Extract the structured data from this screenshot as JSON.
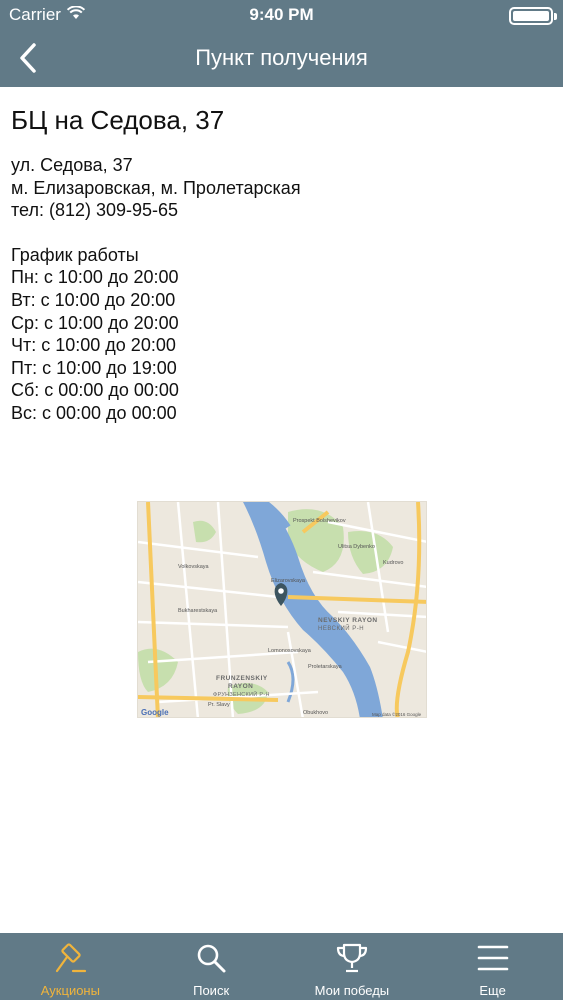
{
  "status_bar": {
    "carrier": "Carrier",
    "time": "9:40 PM"
  },
  "nav": {
    "title": "Пункт получения",
    "back_icon": "chevron-left-icon"
  },
  "place": {
    "title": "БЦ на Седова, 37",
    "address": "ул. Седова, 37",
    "metro": "м. Елизаровская, м. Пролетарская",
    "phone": "тел: (812) 309-95-65"
  },
  "schedule": {
    "heading": "График работы",
    "days": [
      "Пн: с 10:00 до 20:00",
      "Вт: с 10:00 до 20:00",
      "Ср: с 10:00 до 20:00",
      "Чт: с 10:00 до 20:00",
      "Пт: с 10:00 до 19:00",
      "Сб: с 00:00 до 00:00",
      "Вс: с 00:00 до 00:00"
    ]
  },
  "map": {
    "google_label": "Google",
    "copyright": "Map data ©2016 Google",
    "labels": {
      "district_nevsky": "NEVSKIY RAYON",
      "district_nevsky_ru": "НЕВСКИЙ Р-Н",
      "district_frunzensky": "FRUNZENSKIY",
      "district_frunzensky_2": "RAYON",
      "district_frunzensky_ru": "ФРУНЗЕНСКИЙ Р-Н",
      "obukhovo": "Obukhovo",
      "proletarskaya": "Proletarskaya",
      "elizarovskaya": "Elizarovskaya",
      "volkovskaya": "Volkovskaya",
      "kupchino": "Kudrovo",
      "prospekt_bolshevikov": "Prospekt Bolshevikov",
      "dybenko": "Ulitsa Dybenko",
      "bukharestskaya": "Bukharestskaya",
      "fr_slavy": "Pr. Slavy",
      "lomonosovskaya": "Lomonosovskaya"
    },
    "colors": {
      "land": "#ede8de",
      "water": "#7fa7d8",
      "park": "#c7dfae",
      "major_road": "#f7c95e",
      "minor_road": "#ffffff",
      "pin": "#3d5560"
    }
  },
  "tabs": [
    {
      "label": "Аукционы",
      "icon": "gavel-icon",
      "active": true
    },
    {
      "label": "Поиск",
      "icon": "search-icon",
      "active": false
    },
    {
      "label": "Мои победы",
      "icon": "trophy-icon",
      "active": false
    },
    {
      "label": "Еще",
      "icon": "menu-icon",
      "active": false
    }
  ],
  "colors": {
    "header": "#617a87",
    "active_tab": "#f0b43c",
    "inactive_tab": "#ffffff"
  }
}
